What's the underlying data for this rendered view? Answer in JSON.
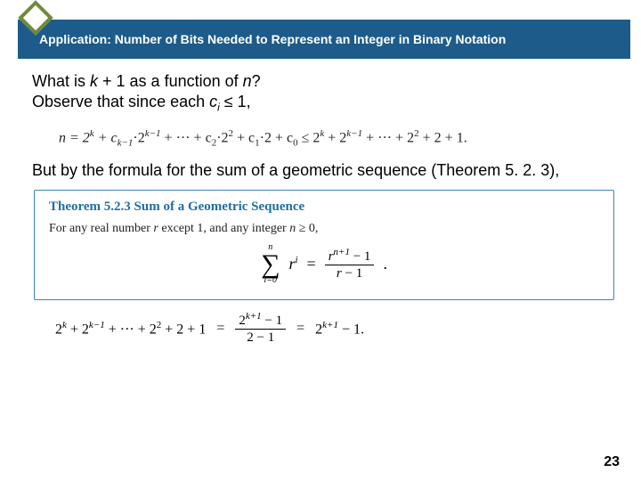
{
  "header": {
    "title": "Application: Number of Bits Needed to Represent an Integer in Binary Notation"
  },
  "body": {
    "line1a": "What is ",
    "line1_k": "k",
    "line1b": " + 1 as a function of ",
    "line1_n": "n",
    "line1c": "?",
    "line2a": "Observe that since each ",
    "line2_c": "c",
    "line2_i": "i",
    "line2b": " ≤ 1,",
    "formula1_lhs": "n  =  2",
    "formula1_rest": " + c",
    "formula1_k1": "k−1",
    "formula1_dot2": "·2",
    "formula1_mid": " + ··· + c",
    "formula1_s2": "2",
    "formula1_d22": "·2",
    "formula1_sq": "2",
    "formula1_pc1": " + c",
    "formula1_s1": "1",
    "formula1_d2p": "·2 + c",
    "formula1_s0": "0",
    "formula1_leq": "   ≤   2",
    "formula1_rk": "k",
    "formula1_p2": " + 2",
    "formula1_rk1": "k−1",
    "formula1_tail": " + ··· + 2",
    "formula1_t2": "2",
    "formula1_end": " + 2 + 1.",
    "line3": "But by the formula for the sum of a geometric sequence (Theorem 5. 2. 3),",
    "theorem": {
      "title": "Theorem 5.2.3 Sum of a Geometric Sequence",
      "body_a": "For any real number ",
      "body_r": "r",
      "body_b": " except 1, and any integer ",
      "body_n": "n",
      "body_c": " ≥ 0,",
      "sigma_top": "n",
      "sigma_bot": "i=0",
      "sigma_sym": "∑",
      "rterm_r": "r",
      "rterm_i": "i",
      "eq": "=",
      "frac_num_r": "r",
      "frac_num_exp": "n+1",
      "frac_num_tail": " − 1",
      "frac_den_r": "r",
      "frac_den_tail": " − 1",
      "period": "."
    },
    "final": {
      "lhs_2": "2",
      "lhs_k": "k",
      "lhs_p": " + 2",
      "lhs_k1": "k−1",
      "lhs_mid": " + ··· + 2",
      "lhs_2sq": "2",
      "lhs_tail": " + 2 + 1",
      "eq1": "=",
      "frac_num_2": "2",
      "frac_num_exp": "k+1",
      "frac_num_tail": " − 1",
      "frac_den": "2 − 1",
      "eq2": "=",
      "rhs_2": "2",
      "rhs_exp": "k+1",
      "rhs_tail": " − 1."
    }
  },
  "page_number": "23"
}
